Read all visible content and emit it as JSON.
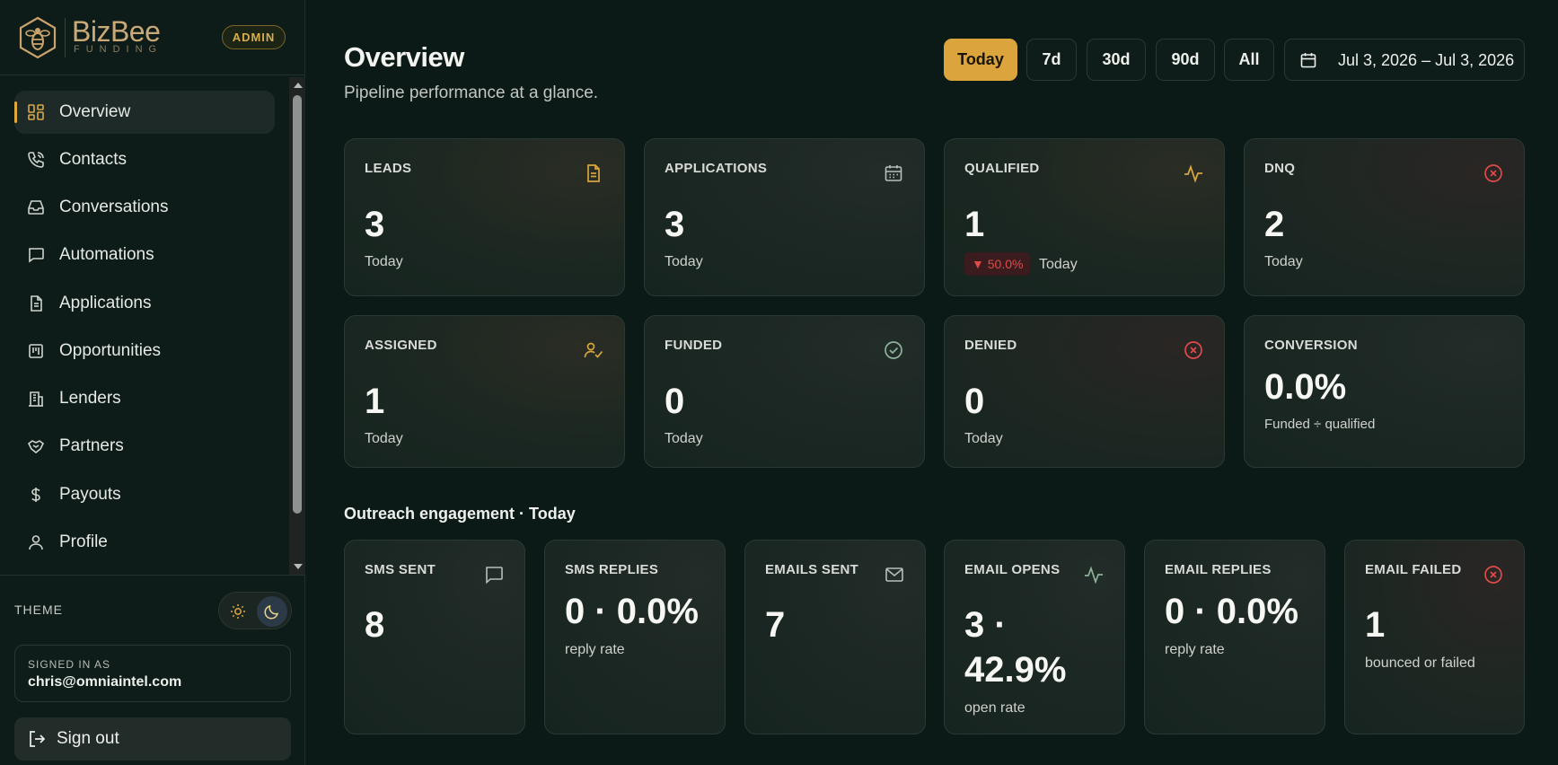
{
  "brand": {
    "name": "BizBee",
    "subtitle": "FUNDING",
    "role_badge": "ADMIN"
  },
  "sidebar": {
    "items": [
      {
        "label": "Overview",
        "icon": "grid-icon",
        "active": true
      },
      {
        "label": "Contacts",
        "icon": "phone-icon"
      },
      {
        "label": "Conversations",
        "icon": "inbox-icon"
      },
      {
        "label": "Automations",
        "icon": "chat-bubble-icon"
      },
      {
        "label": "Applications",
        "icon": "document-icon"
      },
      {
        "label": "Opportunities",
        "icon": "kanban-icon"
      },
      {
        "label": "Lenders",
        "icon": "building-icon"
      },
      {
        "label": "Partners",
        "icon": "handshake-icon"
      },
      {
        "label": "Payouts",
        "icon": "dollar-icon"
      },
      {
        "label": "Profile",
        "icon": "user-icon"
      }
    ],
    "theme_label": "THEME",
    "theme_active": "dark",
    "signed_in_label": "SIGNED IN AS",
    "signed_in_email": "chris@omniaintel.com",
    "sign_out_label": "Sign out"
  },
  "header": {
    "title": "Overview",
    "subtitle": "Pipeline performance at a glance.",
    "ranges": [
      "Today",
      "7d",
      "30d",
      "90d",
      "All"
    ],
    "active_range": "Today",
    "date_range": "Jul 3, 2026 – Jul 3, 2026"
  },
  "stats": [
    {
      "label": "LEADS",
      "value": "3",
      "sub": "Today",
      "icon": "document-icon"
    },
    {
      "label": "APPLICATIONS",
      "value": "3",
      "sub": "Today",
      "icon": "calendar-icon"
    },
    {
      "label": "QUALIFIED",
      "value": "1",
      "delta": "▼ 50.0%",
      "sub": "Today",
      "icon": "activity-icon"
    },
    {
      "label": "DNQ",
      "value": "2",
      "sub": "Today",
      "icon": "x-circle-icon"
    },
    {
      "label": "ASSIGNED",
      "value": "1",
      "sub": "Today",
      "icon": "user-check-icon"
    },
    {
      "label": "FUNDED",
      "value": "0",
      "sub": "Today",
      "icon": "check-circle-icon"
    },
    {
      "label": "DENIED",
      "value": "0",
      "sub": "Today",
      "icon": "x-circle-icon"
    },
    {
      "label": "CONVERSION",
      "value": "0.0%",
      "sub": "Funded ÷ qualified"
    }
  ],
  "outreach": {
    "title": "Outreach engagement · Today",
    "cards": [
      {
        "label": "SMS SENT",
        "value": "8",
        "icon": "chat-bubble-icon"
      },
      {
        "label": "SMS REPLIES",
        "value": "0 · 0.0%",
        "sub": "reply rate"
      },
      {
        "label": "EMAILS SENT",
        "value": "7",
        "icon": "mail-icon"
      },
      {
        "label": "EMAIL OPENS",
        "value_line1": "3 ·",
        "value_line2": "42.9%",
        "sub": "open rate",
        "icon": "activity-icon"
      },
      {
        "label": "EMAIL REPLIES",
        "value": "0 · 0.0%",
        "sub": "reply rate"
      },
      {
        "label": "EMAIL FAILED",
        "value": "1",
        "sub": "bounced or failed",
        "icon": "x-circle-icon"
      }
    ]
  },
  "colors": {
    "accent": "#dba43c",
    "background": "#0b1a17",
    "danger": "#e04a4a"
  }
}
